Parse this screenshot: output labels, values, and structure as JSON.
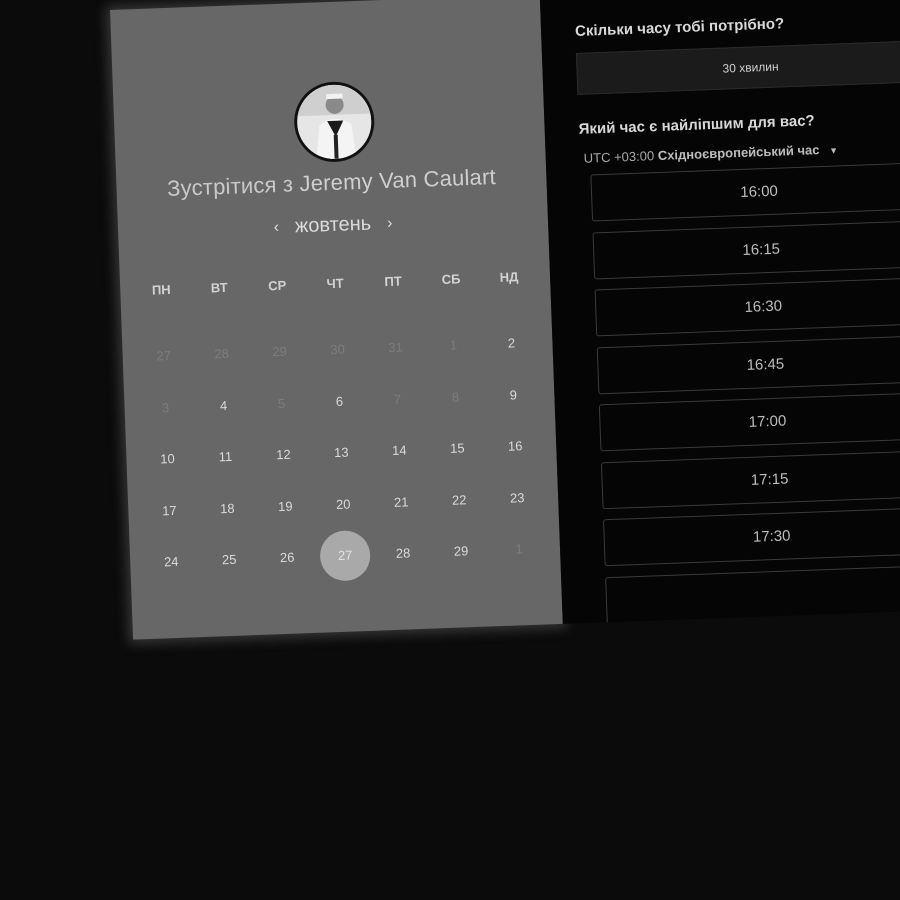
{
  "header": {
    "title_prefix": "Зустрітися з",
    "host_name": "Jeremy Van Caulart"
  },
  "calendar": {
    "month": "жовтень",
    "prev_icon": "chevron-left-icon",
    "next_icon": "chevron-right-icon",
    "weekdays": [
      "ПН",
      "ВТ",
      "СР",
      "ЧТ",
      "ПТ",
      "СБ",
      "НД"
    ],
    "days": [
      {
        "label": "27",
        "muted": true
      },
      {
        "label": "28",
        "muted": true
      },
      {
        "label": "29",
        "muted": true
      },
      {
        "label": "30",
        "muted": true
      },
      {
        "label": "31",
        "muted": true
      },
      {
        "label": "1",
        "muted": true
      },
      {
        "label": "2",
        "muted": false
      },
      {
        "label": "3",
        "muted": true
      },
      {
        "label": "4",
        "muted": false
      },
      {
        "label": "5",
        "muted": true
      },
      {
        "label": "6",
        "muted": false
      },
      {
        "label": "7",
        "muted": true
      },
      {
        "label": "8",
        "muted": true
      },
      {
        "label": "9",
        "muted": false
      },
      {
        "label": "10",
        "muted": false
      },
      {
        "label": "11",
        "muted": false
      },
      {
        "label": "12",
        "muted": false
      },
      {
        "label": "13",
        "muted": false
      },
      {
        "label": "14",
        "muted": false
      },
      {
        "label": "15",
        "muted": false
      },
      {
        "label": "16",
        "muted": false
      },
      {
        "label": "17",
        "muted": false
      },
      {
        "label": "18",
        "muted": false
      },
      {
        "label": "19",
        "muted": false
      },
      {
        "label": "20",
        "muted": false
      },
      {
        "label": "21",
        "muted": false
      },
      {
        "label": "22",
        "muted": false
      },
      {
        "label": "23",
        "muted": false
      },
      {
        "label": "24",
        "muted": false
      },
      {
        "label": "25",
        "muted": false
      },
      {
        "label": "26",
        "muted": false
      },
      {
        "label": "27",
        "muted": false,
        "selected": true
      },
      {
        "label": "28",
        "muted": false
      },
      {
        "label": "29",
        "muted": false
      },
      {
        "label": "1",
        "muted": true
      }
    ]
  },
  "booking": {
    "duration_question": "Скільки часу тобі потрібно?",
    "duration_value": "30 хвилин",
    "time_question": "Який час є найліпшим для вас?",
    "timezone_offset": "UTC +03:00",
    "timezone_name": "Східноєвропейський час",
    "timezone_icon": "caret-down-icon",
    "slots": [
      "16:00",
      "16:15",
      "16:30",
      "16:45",
      "17:00",
      "17:15",
      "17:30",
      ""
    ]
  },
  "colors": {
    "left_panel": "#676767",
    "right_panel": "#050505",
    "selected_day": "#a9a9a9"
  }
}
